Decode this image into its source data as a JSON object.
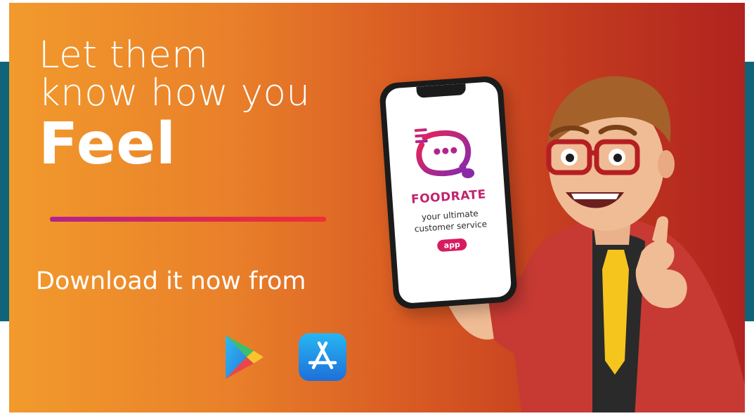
{
  "headline": {
    "line1": "Let them",
    "line2": "know how you",
    "line3": "Feel"
  },
  "download_text": "Download it now from",
  "stores": [
    {
      "icon": "google-play-icon"
    },
    {
      "icon": "app-store-icon"
    }
  ],
  "phone": {
    "app_name": "FOODRATE",
    "tagline_line1": "your ultimate",
    "tagline_line2": "customer service",
    "badge": "app"
  },
  "colors": {
    "gradient_start": "#f29a2c",
    "gradient_end": "#b0231f",
    "side_band": "#0f6479",
    "brand_pink": "#c1246f",
    "underline_start": "#b3218f",
    "underline_end": "#ef2f35"
  }
}
